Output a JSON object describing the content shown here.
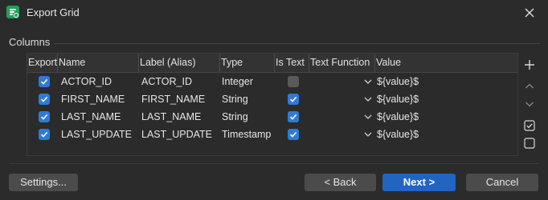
{
  "window": {
    "title": "Export Grid",
    "close_icon": "close-icon",
    "app_icon": "grid-export-icon"
  },
  "section": {
    "label": "Columns"
  },
  "grid": {
    "headers": {
      "export": "Export",
      "name": "Name",
      "label": "Label (Alias)",
      "type": "Type",
      "is_text": "Is Text",
      "text_function": "Text Function",
      "value": "Value"
    },
    "rows": [
      {
        "export": true,
        "name": "ACTOR_ID",
        "label": "ACTOR_ID",
        "type": "Integer",
        "is_text": false,
        "text_function": "",
        "value": "${value}$"
      },
      {
        "export": true,
        "name": "FIRST_NAME",
        "label": "FIRST_NAME",
        "type": "String",
        "is_text": true,
        "text_function": "",
        "value": "${value}$"
      },
      {
        "export": true,
        "name": "LAST_NAME",
        "label": "LAST_NAME",
        "type": "String",
        "is_text": true,
        "text_function": "",
        "value": "${value}$"
      },
      {
        "export": true,
        "name": "LAST_UPDATE",
        "label": "LAST_UPDATE",
        "type": "Timestamp",
        "is_text": true,
        "text_function": "",
        "value": "${value}$"
      }
    ]
  },
  "side_toolbar": {
    "icons": [
      "add-icon",
      "move-up-icon",
      "move-down-icon",
      "check-all-icon",
      "uncheck-all-icon"
    ]
  },
  "footer": {
    "settings_label": "Settings...",
    "back_label": "< Back",
    "next_label": "Next >",
    "cancel_label": "Cancel"
  },
  "colors": {
    "accent": "#2164c2",
    "checkbox": "#2f7ad6",
    "app_icon": "#22a05a"
  }
}
